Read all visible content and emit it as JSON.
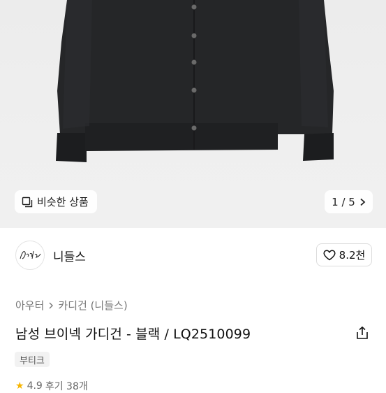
{
  "gallery": {
    "similar_label": "비슷한 상품",
    "pager_text": "1 / 5"
  },
  "brand": {
    "name": "니들스",
    "logo_text": "Needles",
    "likes": "8.2천"
  },
  "breadcrumb": {
    "level1": "아우터",
    "separator": ">",
    "level2": "카디건 (니들스)"
  },
  "product": {
    "title": "남성 브이넥 가디건 - 블랙 / LQ2510099",
    "tag": "부티크"
  },
  "rating": {
    "score": "4.9",
    "reviews": "후기 38개"
  },
  "colors": {
    "garment": "#252628",
    "star": "#f7b500"
  }
}
